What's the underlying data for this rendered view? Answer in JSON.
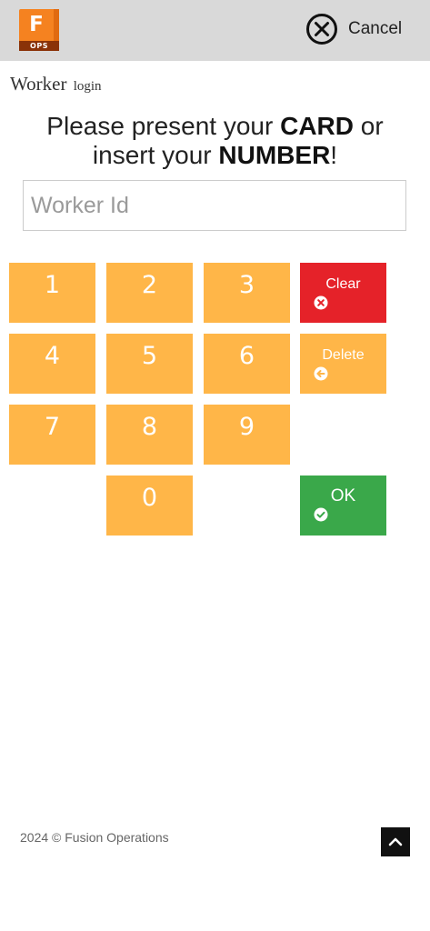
{
  "header": {
    "logo_letter": "F",
    "logo_caption": "OPS",
    "cancel_label": "Cancel"
  },
  "login": {
    "title_main": "Worker",
    "title_sub": "login",
    "prompt_part1": "Please present your ",
    "prompt_bold1": "CARD",
    "prompt_part2": " or",
    "prompt_part3": "insert your ",
    "prompt_bold2": "NUMBER",
    "prompt_part4": "!",
    "input_placeholder": "Worker Id",
    "input_value": ""
  },
  "keypad": {
    "digits": [
      "1",
      "2",
      "3",
      "4",
      "5",
      "6",
      "7",
      "8",
      "9",
      "0"
    ],
    "clear_label": "Clear",
    "delete_label": "Delete",
    "ok_label": "OK"
  },
  "footer": {
    "text": "2024 © Fusion Operations"
  },
  "colors": {
    "header_bg": "#d9d9d9",
    "logo_orange": "#f58220",
    "key_orange": "#ffb648",
    "clear_red": "#e52229",
    "ok_green": "#3aa84a"
  },
  "icons": {
    "cancel": "close-circle-icon",
    "clear": "x-circle-icon",
    "delete": "arrow-left-circle-icon",
    "ok": "check-circle-icon",
    "to_top": "chevron-up-icon"
  }
}
